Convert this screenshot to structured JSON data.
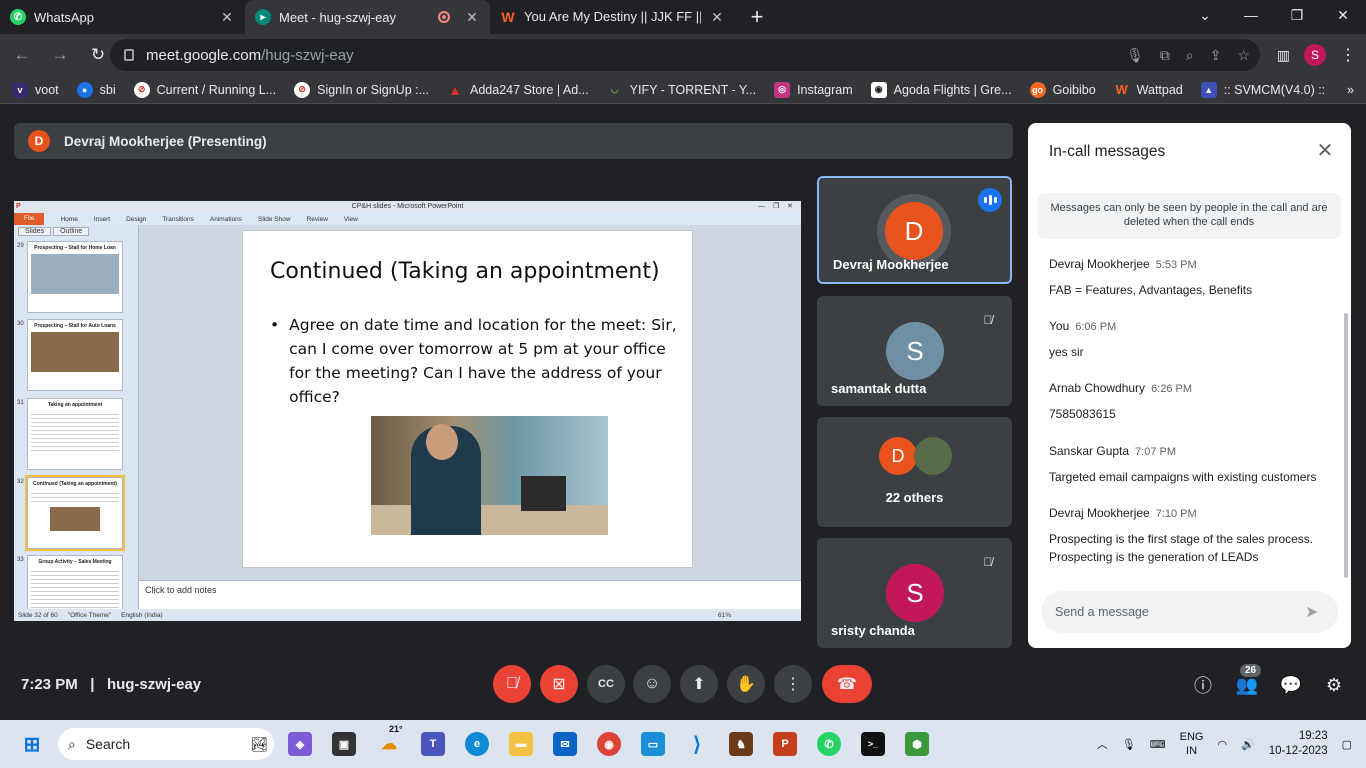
{
  "browser": {
    "tabs": [
      {
        "title": "WhatsApp",
        "icon": "whatsapp-icon",
        "color": "#25d366"
      },
      {
        "title": "Meet - hug-szwj-eay",
        "icon": "google-meet-icon",
        "color": "#00897b"
      },
      {
        "title": "You Are My Destiny || JJK FF || ✓",
        "icon": "wattpad-icon",
        "color": "#ff6122"
      }
    ],
    "url_host": "meet.google.com",
    "url_path": "/hug-szwj-eay",
    "profile_initial": "S",
    "bookmarks": [
      {
        "label": "voot",
        "icon": "voot-icon",
        "color": "#3a2b6b"
      },
      {
        "label": "sbi",
        "icon": "sbi-icon",
        "color": "#1a73e8"
      },
      {
        "label": "Current / Running L...",
        "icon": "blocked-icon",
        "color": "#d93025"
      },
      {
        "label": "SignIn or SignUp :...",
        "icon": "blocked-icon",
        "color": "#d93025"
      },
      {
        "label": "Adda247 Store | Ad...",
        "icon": "adda-icon",
        "color": "#d93025"
      },
      {
        "label": "YIFY - TORRENT - Y...",
        "icon": "yify-icon",
        "color": "#6aa84f"
      },
      {
        "label": "Instagram",
        "icon": "instagram-icon",
        "color": "#c13584"
      },
      {
        "label": "Agoda Flights | Gre...",
        "icon": "agoda-icon",
        "color": "#5f6368"
      },
      {
        "label": "Goibibo",
        "icon": "goibibo-icon",
        "color": "#f26722"
      },
      {
        "label": "Wattpad",
        "icon": "wattpad-icon",
        "color": "#ff6122"
      },
      {
        "label": ":: SVMCM(V4.0) ::",
        "icon": "svmcm-icon",
        "color": "#3f51b5"
      }
    ]
  },
  "presenting": {
    "initial": "D",
    "label": "Devraj Mookherjee (Presenting)"
  },
  "ppt": {
    "window_title": "CP&H slides - Microsoft PowerPoint",
    "ribbon": [
      "File",
      "Home",
      "Insert",
      "Design",
      "Transitions",
      "Animations",
      "Slide Show",
      "Review",
      "View"
    ],
    "panel_tabs": [
      "Slides",
      "Outline"
    ],
    "thumbnails": [
      {
        "num": "29",
        "title": "Prospecting – Stall for Home Loan"
      },
      {
        "num": "30",
        "title": "Prospecting – Stall for Auto Loans"
      },
      {
        "num": "31",
        "title": "Taking an appointment"
      },
      {
        "num": "32",
        "title": "Continued (Taking an appointment)"
      },
      {
        "num": "33",
        "title": "Group Activity – Sales Meeting"
      }
    ],
    "slide_title": "Continued (Taking an appointment)",
    "slide_bullet": "Agree on date time  and location for the meet: Sir, can I come over tomorrow at 5 pm at your office for the meeting? Can I have the address of your office?",
    "notes": "Click to add notes",
    "status": [
      "Slide 32 of 60",
      "\"Office Theme\"",
      "English (India)"
    ],
    "zoom": "61%"
  },
  "tiles": [
    {
      "initial": "D",
      "name": "Devraj Mookherjee",
      "color": "#e8531d"
    },
    {
      "initial": "S",
      "name": "samantak dutta",
      "color": "#6f8fa3"
    },
    {
      "initial": "D",
      "name": "22 others",
      "color": "#e8531d"
    },
    {
      "initial": "S",
      "name": "sristy chanda",
      "color": "#c2185b"
    }
  ],
  "chat": {
    "title": "In-call messages",
    "notice": "Messages can only be seen by people in the call and are deleted when the call ends",
    "messages": [
      {
        "sender": "Devraj Mookherjee",
        "time": "5:53 PM",
        "text": "FAB = Features, Advantages, Benefits"
      },
      {
        "sender": "You",
        "time": "6:06 PM",
        "text": "yes sir"
      },
      {
        "sender": "Arnab Chowdhury",
        "time": "6:26 PM",
        "text": "7585083615"
      },
      {
        "sender": "Sanskar Gupta",
        "time": "7:07 PM",
        "text": "Targeted email campaigns with existing customers"
      },
      {
        "sender": "Devraj Mookherjee",
        "time": "7:10 PM",
        "text": "Prospecting is the first stage of the sales process. Prospecting is the generation of LEADs"
      }
    ],
    "input_placeholder": "Send a message"
  },
  "meeting": {
    "time": "7:23 PM",
    "separator": "|",
    "code": "hug-szwj-eay",
    "participants": "26"
  },
  "taskbar": {
    "search_label": "Search",
    "weather": "21°",
    "lang1": "ENG",
    "lang2": "IN",
    "time": "19:23",
    "date": "10-12-2023"
  }
}
